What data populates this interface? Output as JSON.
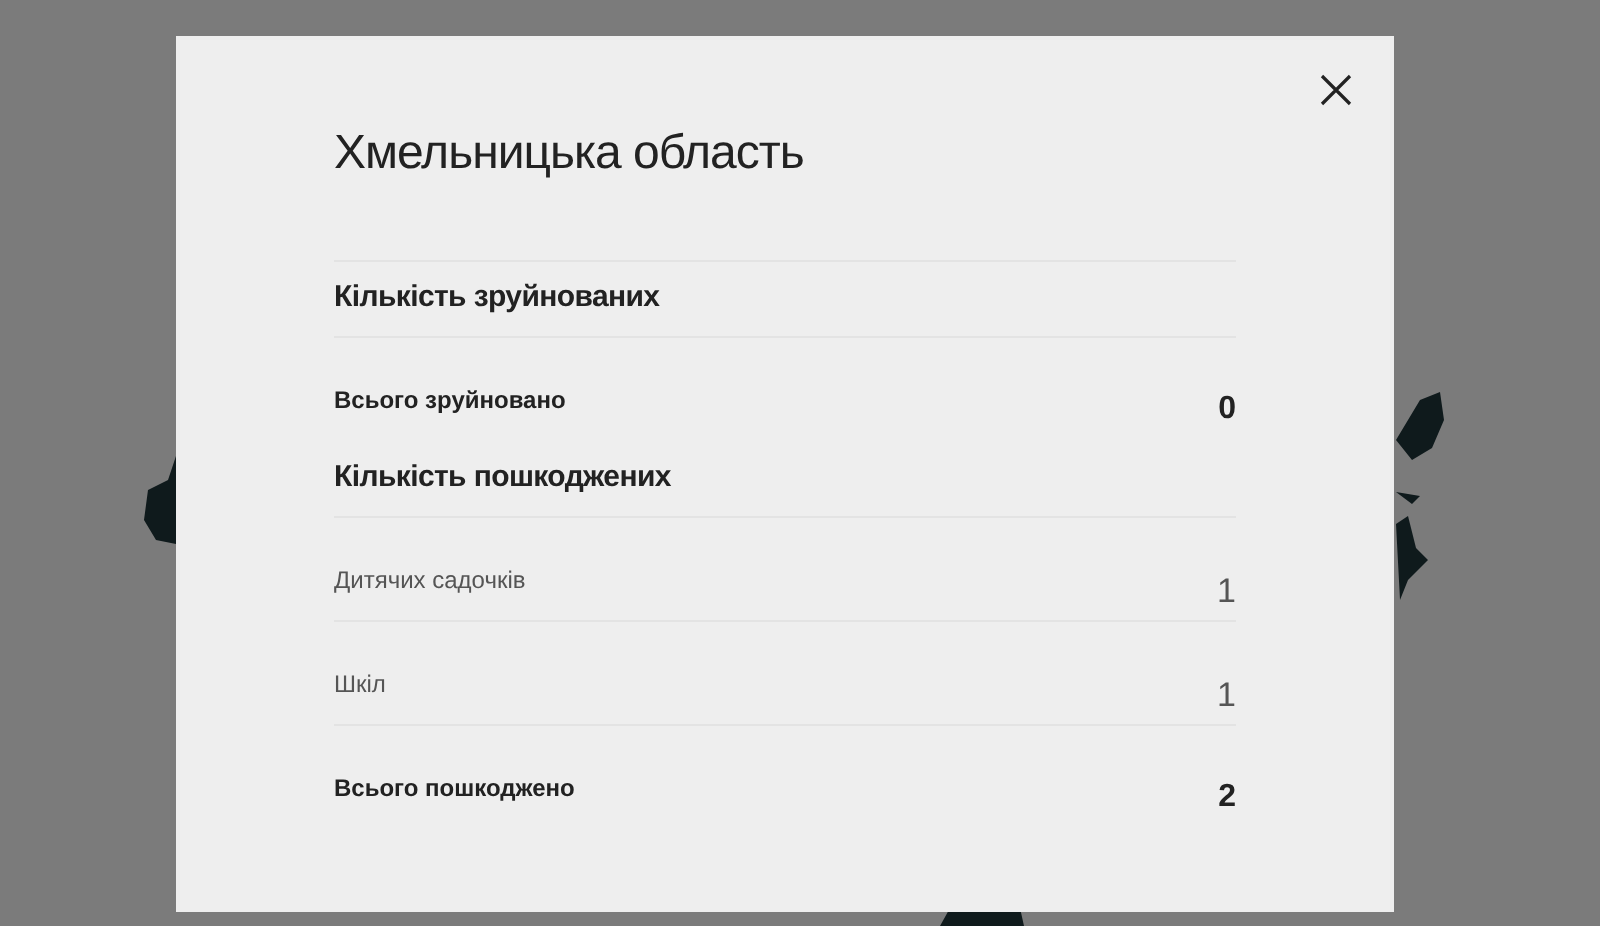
{
  "dialog": {
    "title": "Хмельницька область",
    "sections": [
      {
        "heading": "Кількість зруйнованих",
        "rows": [
          {
            "kind": "total",
            "label": "Всього зруйновано",
            "value": "0"
          }
        ]
      },
      {
        "heading": "Кількість пошкоджених",
        "rows": [
          {
            "kind": "item",
            "label": "Дитячих садочків",
            "value": "1"
          },
          {
            "kind": "item",
            "label": "Шкіл",
            "value": "1"
          },
          {
            "kind": "total",
            "label": "Всього пошкоджено",
            "value": "2"
          }
        ]
      }
    ]
  }
}
